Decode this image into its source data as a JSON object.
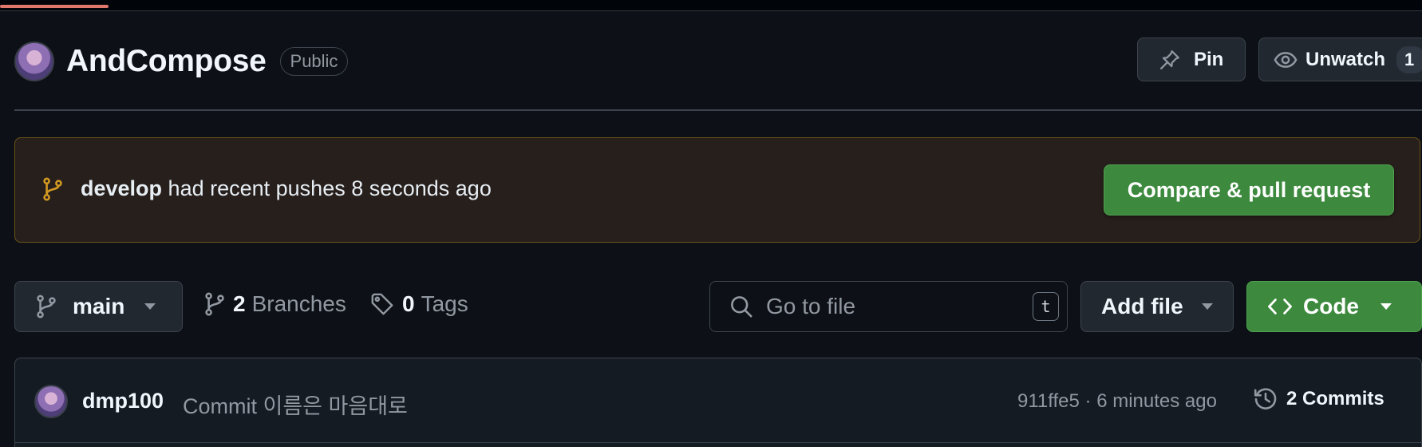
{
  "repo": {
    "name": "AndCompose",
    "visibility": "Public"
  },
  "header_actions": {
    "pin_label": "Pin",
    "unwatch_label": "Unwatch",
    "watch_count": "1"
  },
  "banner": {
    "branch": "develop",
    "message": "had recent pushes 8 seconds ago",
    "button_label": "Compare & pull request"
  },
  "toolbar": {
    "current_branch": "main",
    "branches_count": "2",
    "branches_label": "Branches",
    "tags_count": "0",
    "tags_label": "Tags",
    "search_placeholder": "Go to file",
    "search_shortcut": "t",
    "add_file_label": "Add file",
    "code_label": "Code"
  },
  "latest_commit": {
    "author": "dmp100",
    "message": "Commit 이름은 마음대로",
    "hash_time": "911ffe5 · 6 minutes ago",
    "commits_label": "2 Commits"
  },
  "colors": {
    "background": "#0d1117",
    "accent_green": "#3d8a3e",
    "banner_bg": "#271f1b",
    "banner_icon": "#d29922"
  }
}
